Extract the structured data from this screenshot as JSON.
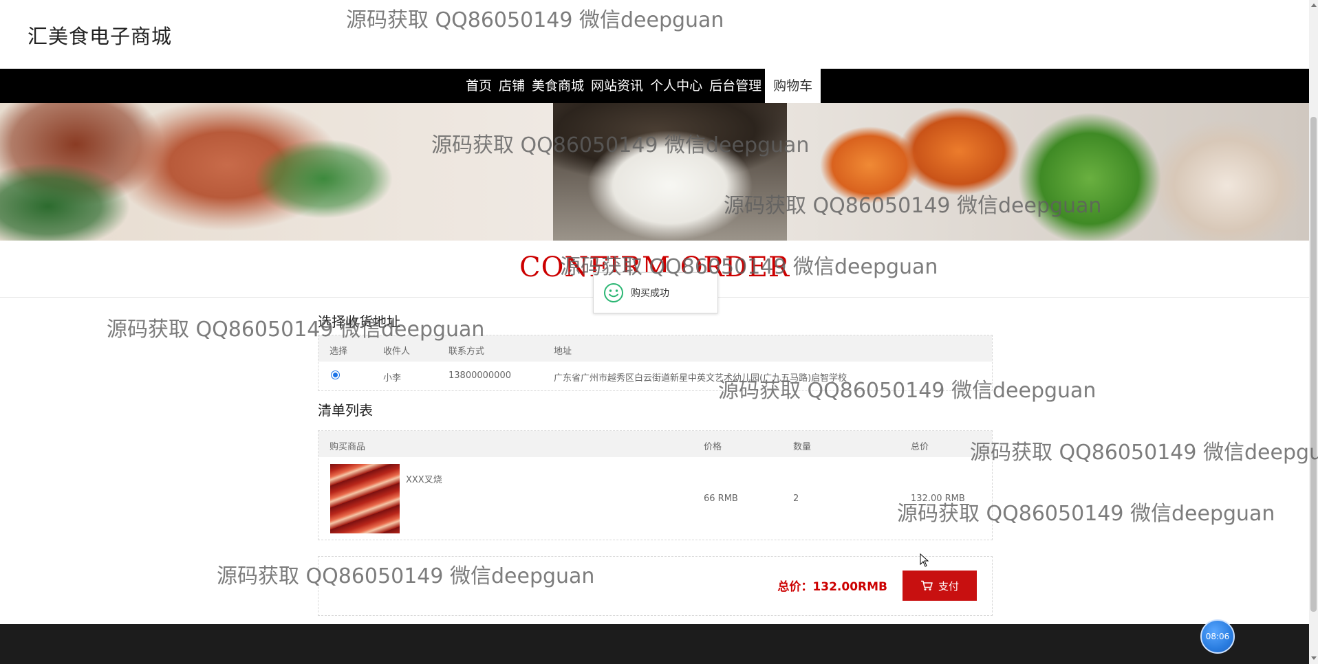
{
  "site": {
    "title": "汇美食电子商城"
  },
  "nav": {
    "items": [
      "首页",
      "店铺",
      "美食商城",
      "网站资讯",
      "个人中心",
      "后台管理"
    ],
    "active": "购物车"
  },
  "section_title": "CONFIRM ORDER",
  "toast": {
    "text": "购买成功",
    "icon": "smile-icon"
  },
  "address": {
    "heading": "选择收货地址",
    "columns": [
      "选择",
      "收件人",
      "联系方式",
      "地址"
    ],
    "rows": [
      {
        "selected": true,
        "name": "小李",
        "phone": "13800000000",
        "address": "广东省广州市越秀区白云街道新星中英文艺术幼儿园(广九五马路)启智学校"
      }
    ]
  },
  "items": {
    "heading": "清单列表",
    "columns": [
      "购买商品",
      "价格",
      "数量",
      "总价"
    ],
    "rows": [
      {
        "name": "XXX叉烧",
        "price": "66 RMB",
        "qty": "2",
        "total": "132.00 RMB"
      }
    ]
  },
  "checkout": {
    "total_label": "总价：132.00RMB",
    "pay_label": "支付",
    "pay_icon": "cart-icon"
  },
  "clock": "08:06",
  "watermark_text": "源码获取 QQ86050149 微信deepguan",
  "watermark_partial": "源码获取 QQ86050149 微信deepgua"
}
